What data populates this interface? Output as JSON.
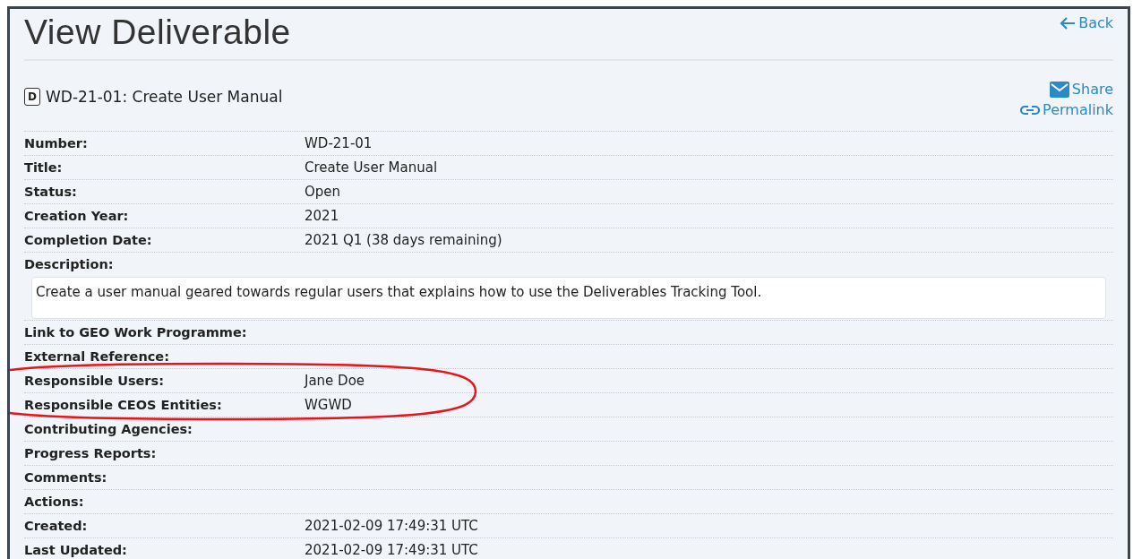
{
  "page": {
    "title": "View Deliverable",
    "back_link": "Back"
  },
  "deliverable": {
    "badge": "D",
    "heading": "WD-21-01: Create User Manual",
    "share": "Share",
    "permalink": "Permalink"
  },
  "fields": [
    {
      "kind": "line",
      "label": "Number:",
      "value": "WD-21-01"
    },
    {
      "kind": "line",
      "label": "Title:",
      "value": "Create User Manual"
    },
    {
      "kind": "line",
      "label": "Status:",
      "value": "Open"
    },
    {
      "kind": "line",
      "label": "Creation Year:",
      "value": "2021"
    },
    {
      "kind": "line",
      "label": "Completion Date:",
      "value": "2021 Q1 (38 days remaining)"
    },
    {
      "kind": "block",
      "label": "Description:",
      "value": "Create a user manual geared towards regular users that explains how to use the Deliverables Tracking Tool."
    },
    {
      "kind": "line",
      "label": "Link to GEO Work Programme:"
    },
    {
      "kind": "line",
      "label": "External Reference:"
    },
    {
      "kind": "line",
      "label": "Responsible Users:",
      "value": "Jane Doe"
    },
    {
      "kind": "line",
      "label": "Responsible CEOS Entities:",
      "value": "WGWD"
    },
    {
      "kind": "line",
      "label": "Contributing Agencies:"
    },
    {
      "kind": "line",
      "label": "Progress Reports:"
    },
    {
      "kind": "line",
      "label": "Comments:"
    },
    {
      "kind": "line",
      "label": "Actions:"
    },
    {
      "kind": "line",
      "label": "Created:",
      "value": "2021-02-09 17:49:31 UTC"
    },
    {
      "kind": "line",
      "label": "Last Updated:",
      "value": "2021-02-09 17:49:31 UTC"
    }
  ]
}
